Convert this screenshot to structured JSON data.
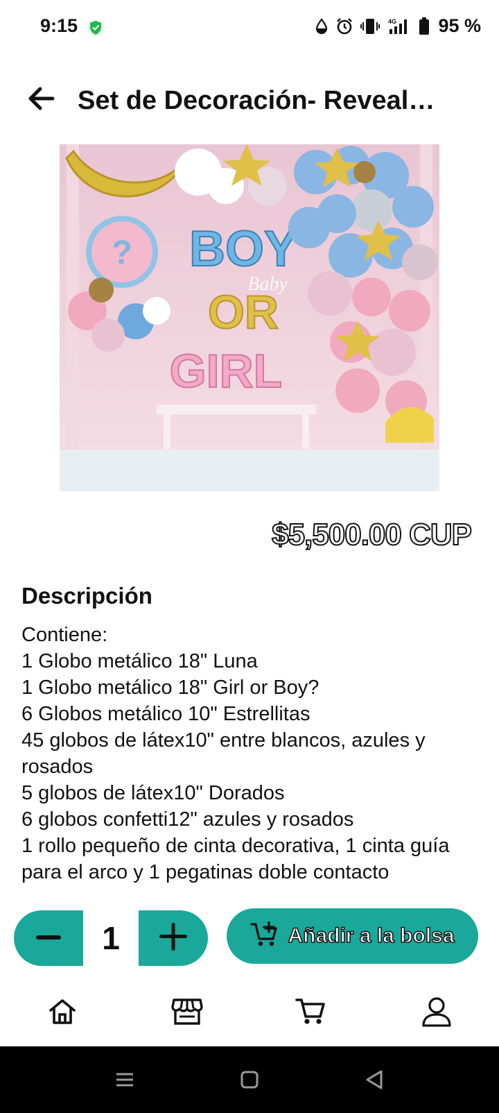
{
  "status_bar": {
    "time": "9:15",
    "battery": "95 %",
    "network": "4G"
  },
  "header": {
    "title": "Set de Decoración- Reveal de Género",
    "back_icon": "arrow-left-icon"
  },
  "product": {
    "image_lettering": [
      "BOY",
      "Baby",
      "OR",
      "GIRL"
    ],
    "price": "$5,500.00 CUP"
  },
  "description": {
    "title": "Descripción",
    "lines": [
      "Contiene:",
      "1 Globo metálico 18\" Luna",
      "1 Globo metálico 18\" Girl or Boy?",
      "6 Globos metálico 10\" Estrellitas",
      "45 globos de látex10\" entre blancos, azules y rosados",
      "5 globos de látex10\" Dorados",
      "6 globos confetti12\" azules y rosados",
      "1 rollo pequeño de cinta decorativa, 1 cinta guía para el arco y 1 pegatinas doble contacto"
    ]
  },
  "purchase": {
    "quantity": "1",
    "add_label": "Añadir a la bolsa",
    "accent_color": "#1aa89a"
  },
  "bottom_nav": {
    "items": [
      "home-icon",
      "store-icon",
      "cart-icon",
      "profile-icon"
    ]
  }
}
